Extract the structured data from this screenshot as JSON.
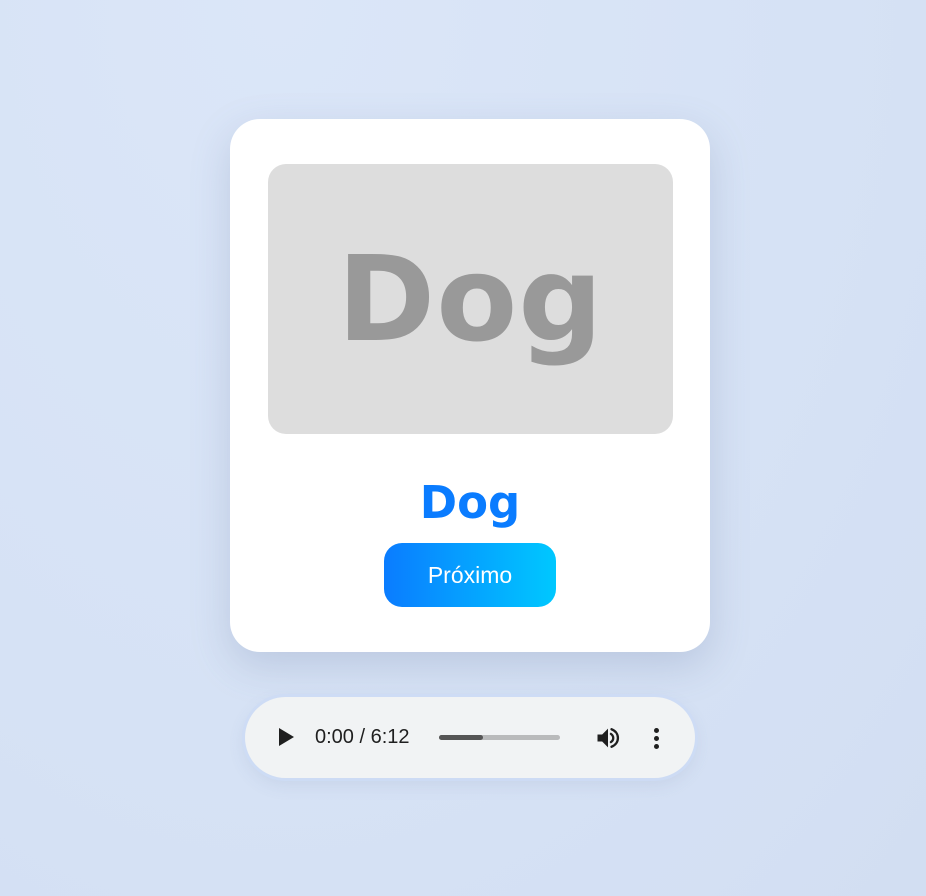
{
  "card": {
    "image_text": "Dog",
    "word": "Dog",
    "next_button_label": "Próximo"
  },
  "audio": {
    "current_time": "0:00",
    "duration": "6:12",
    "time_display": "0:00 / 6:12",
    "progress_fraction": 0.36,
    "play_icon": "play-icon",
    "volume_icon": "volume-icon",
    "more_icon": "more-vertical-icon"
  },
  "colors": {
    "accent": "#0a7cff",
    "accent_gradient_end": "#00c8ff",
    "placeholder_bg": "#dddddd",
    "placeholder_text": "#999999"
  }
}
